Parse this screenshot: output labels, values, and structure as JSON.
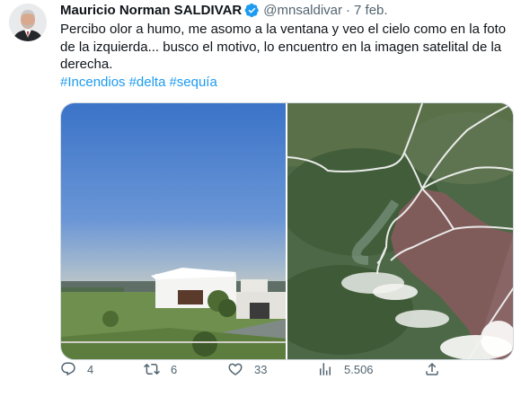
{
  "author": {
    "name": "Mauricio Norman SALDIVAR",
    "handle": "@mnsaldivar",
    "separator": "·",
    "date": "7 feb."
  },
  "tweet": {
    "text": "Percibo olor a humo, me asomo a la ventana y veo el cielo como en la foto de la izquierda... busco el motivo, lo encuentro en la imagen satelital de la derecha.",
    "hashtags": [
      "#Incendios",
      "#delta",
      "#sequía"
    ]
  },
  "metrics": {
    "replies": "4",
    "retweets": "6",
    "likes": "33",
    "views": "5.506"
  },
  "colors": {
    "link": "#1d9bf0",
    "secondary_text": "#536471",
    "verified": "#1d9bf0"
  },
  "icons": [
    "verified-badge-icon",
    "reply-icon",
    "retweet-icon",
    "like-icon",
    "views-icon",
    "share-icon"
  ]
}
